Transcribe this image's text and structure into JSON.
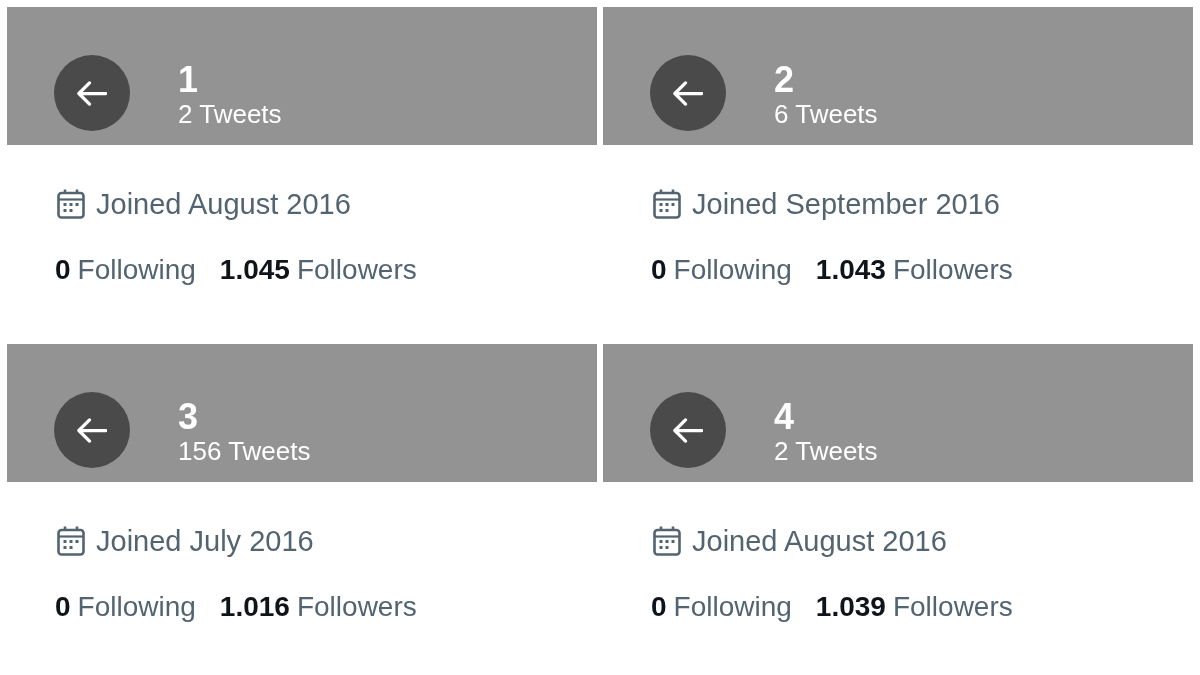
{
  "profiles": [
    {
      "name": "1",
      "tweet_count": "2 Tweets",
      "joined": "Joined August 2016",
      "following": {
        "count": "0",
        "label": "Following"
      },
      "followers": {
        "count": "1.045",
        "label": "Followers"
      }
    },
    {
      "name": "2",
      "tweet_count": "6 Tweets",
      "joined": "Joined September 2016",
      "following": {
        "count": "0",
        "label": "Following"
      },
      "followers": {
        "count": "1.043",
        "label": "Followers"
      }
    },
    {
      "name": "3",
      "tweet_count": "156 Tweets",
      "joined": "Joined July 2016",
      "following": {
        "count": "0",
        "label": "Following"
      },
      "followers": {
        "count": "1.016",
        "label": "Followers"
      }
    },
    {
      "name": "4",
      "tweet_count": "2 Tweets",
      "joined": "Joined August 2016",
      "following": {
        "count": "0",
        "label": "Following"
      },
      "followers": {
        "count": "1.039",
        "label": "Followers"
      }
    }
  ]
}
